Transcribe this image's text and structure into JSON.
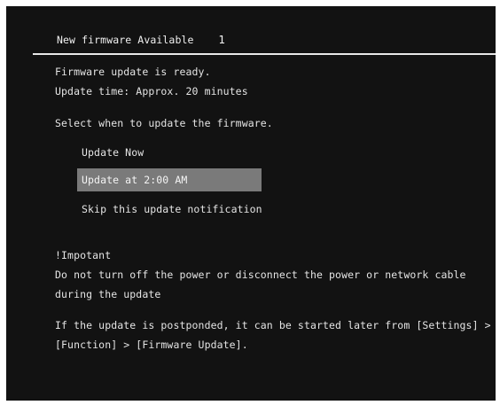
{
  "dialog": {
    "title": "New firmware Available",
    "count": "1",
    "info": [
      "Firmware update is ready.",
      "Update time: Approx. 20 minutes"
    ],
    "prompt": "Select when to update the firmware.",
    "options": [
      {
        "label": "Update Now",
        "selected": false
      },
      {
        "label": "Update at 2:00 AM",
        "selected": true
      },
      {
        "label": "Skip this update notification",
        "selected": false
      }
    ],
    "important": {
      "heading": "!Impotant",
      "lines": [
        "Do not turn off the power or disconnect the power or network cable",
        "during the update"
      ]
    },
    "note": [
      "If the update is postponded, it can be started later from [Settings] >",
      "[Function] > [Firmware Update]."
    ]
  },
  "colors": {
    "background": "#121212",
    "text": "#e4e4e4",
    "highlight": "#7a7a7a",
    "divider": "#e8e8e8"
  }
}
